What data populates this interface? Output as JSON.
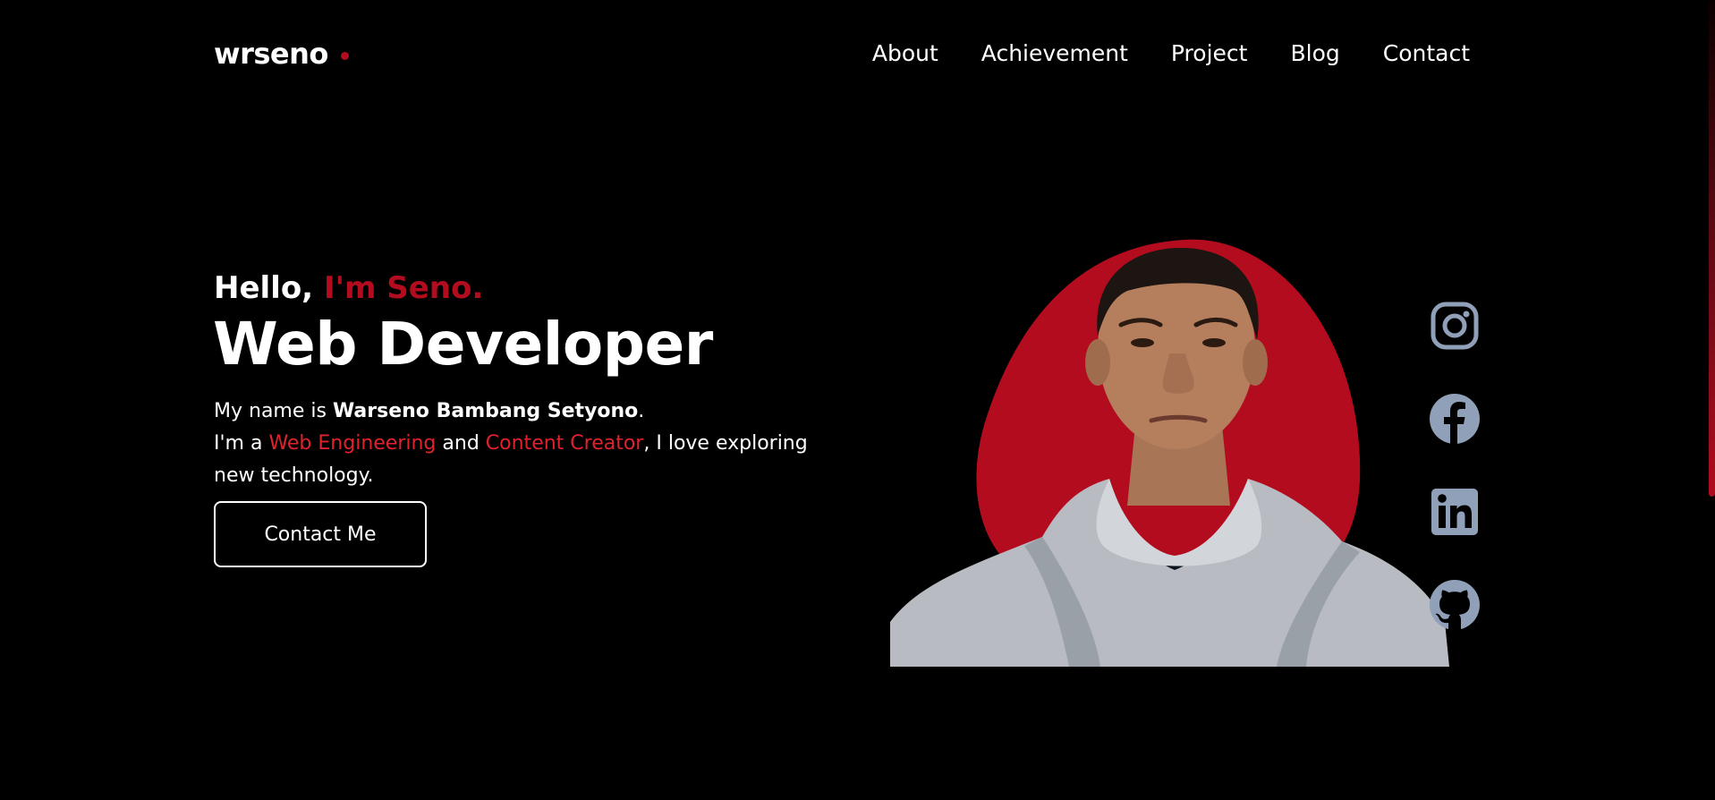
{
  "colors": {
    "background": "#000000",
    "text": "#ffffff",
    "accent": "#b30c1f",
    "accent_bright": "#e0222e",
    "icon": "#8fa0b8"
  },
  "header": {
    "logo": "wrseno",
    "nav": [
      "About",
      "Achievement",
      "Project",
      "Blog",
      "Contact"
    ]
  },
  "hero": {
    "greeting_prefix": "Hello, ",
    "greeting_name": "I'm Seno.",
    "title": "Web Developer",
    "intro": {
      "line1_prefix": "My name is ",
      "full_name": "Warseno Bambang Setyono",
      "line1_suffix": ".",
      "line2_prefix": "I'm a ",
      "role1": "Web Engineering",
      "conj": " and ",
      "role2": "Content Creator",
      "line2_suffix": ", I love exploring new technology."
    },
    "cta_label": "Contact Me"
  },
  "social": [
    {
      "icon": "instagram-icon"
    },
    {
      "icon": "facebook-icon"
    },
    {
      "icon": "linkedin-icon"
    },
    {
      "icon": "github-icon"
    }
  ]
}
